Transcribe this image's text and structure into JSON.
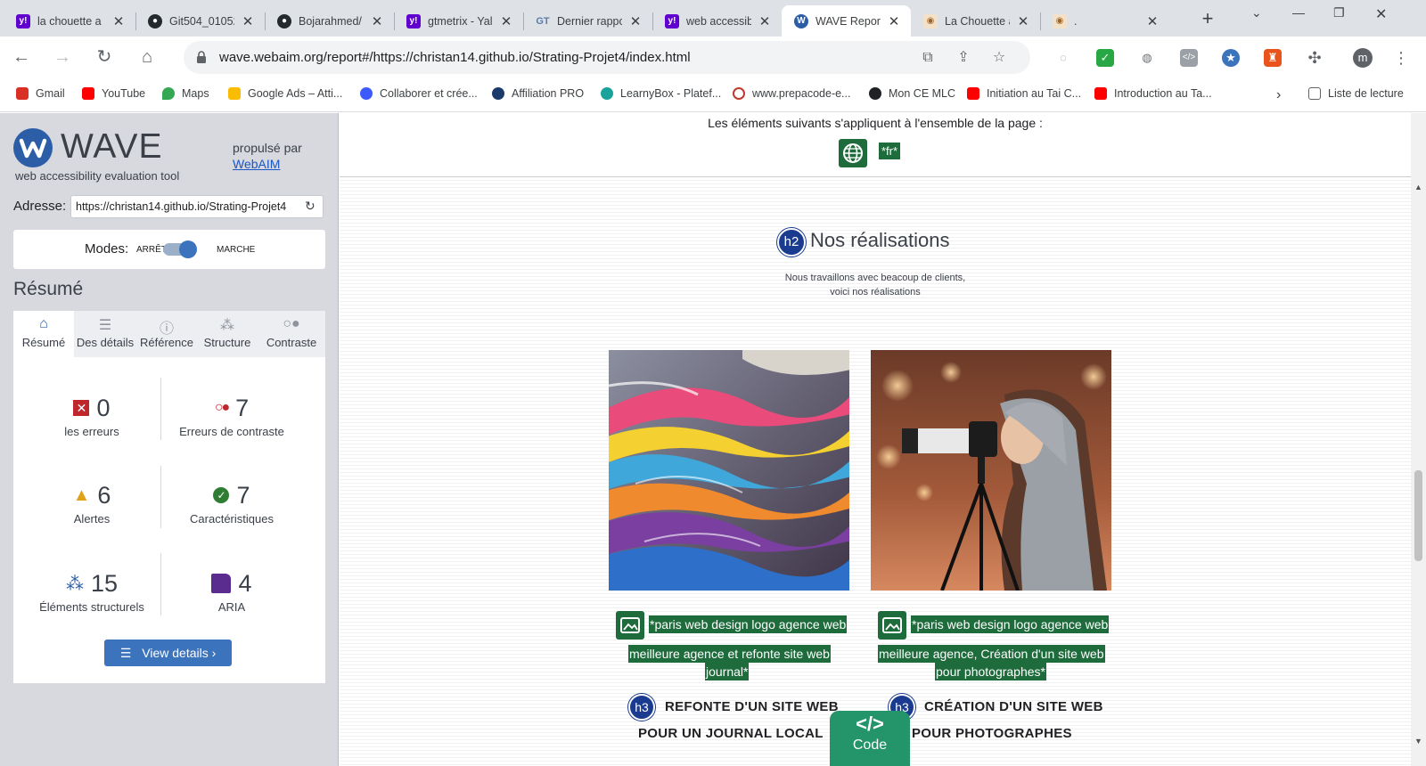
{
  "browser": {
    "tabs": [
      {
        "title": "la chouette a",
        "favicon": "yahoo-icon",
        "color": "#6001d2"
      },
      {
        "title": "Git504_01052",
        "favicon": "github-icon",
        "color": "#24292e"
      },
      {
        "title": "Bojarahmed/",
        "favicon": "github-icon",
        "color": "#24292e"
      },
      {
        "title": "gtmetrix - Yal",
        "favicon": "yahoo-icon",
        "color": "#6001d2"
      },
      {
        "title": "Dernier rappo",
        "favicon": "gtmetrix-icon",
        "color": "#5a7ca8"
      },
      {
        "title": "web accessib",
        "favicon": "yahoo-icon",
        "color": "#6001d2"
      },
      {
        "title": "WAVE Report",
        "favicon": "wave-icon",
        "color": "#2c5ea8"
      },
      {
        "title": "La Chouette a",
        "favicon": "owl-icon",
        "color": "#d9a35a"
      },
      {
        "title": ".",
        "favicon": "owl-icon",
        "color": "#d9a35a"
      }
    ],
    "url": "wave.webaim.org/report#/https://christan14.github.io/Strating-Projet4/index.html",
    "profile_initial": "m",
    "bookmarks": [
      {
        "label": "Gmail",
        "icon": "gmail-icon",
        "color": "#d93025"
      },
      {
        "label": "YouTube",
        "icon": "youtube-icon",
        "color": "#ff0000"
      },
      {
        "label": "Maps",
        "icon": "maps-icon",
        "color": "#34a853"
      },
      {
        "label": "Google Ads – Atti...",
        "icon": "google-ads-icon",
        "color": "#fbbc04"
      },
      {
        "label": "Collaborer et crée...",
        "icon": "collab-icon",
        "color": "#3d5afe"
      },
      {
        "label": "Affiliation PRO",
        "icon": "affiliation-icon",
        "color": "#1b3a6b"
      },
      {
        "label": "LearnyBox - Platef...",
        "icon": "learnybox-icon",
        "color": "#1aa39a"
      },
      {
        "label": "www.prepacode-e...",
        "icon": "prepacode-icon",
        "color": "#c0392b"
      },
      {
        "label": "Mon CE MLC",
        "icon": "mlc-icon",
        "color": "#202124"
      },
      {
        "label": "Initiation au Tai C...",
        "icon": "youtube-icon",
        "color": "#ff0000"
      },
      {
        "label": "Introduction au Ta...",
        "icon": "youtube-icon",
        "color": "#ff0000"
      }
    ],
    "reading_list": "Liste de lecture"
  },
  "wave": {
    "logo": "WAVE",
    "subtitle": "web accessibility evaluation tool",
    "powered_by": "propulsé par",
    "powered_link": "WebAIM",
    "address_label": "Adresse:",
    "address_value": "https://christan14.github.io/Strating-Projet4",
    "modes_label": "Modes:",
    "modes_off": "ARRÊT",
    "modes_on": "MARCHE",
    "summary_title": "Résumé",
    "tabs": [
      {
        "label": "Résumé",
        "icon": "home-icon"
      },
      {
        "label": "Des détails",
        "icon": "list-icon"
      },
      {
        "label": "Référence",
        "icon": "info-icon"
      },
      {
        "label": "Structure",
        "icon": "structure-icon"
      },
      {
        "label": "Contraste",
        "icon": "contrast-icon"
      }
    ],
    "stats": [
      {
        "value": "0",
        "label": "les erreurs",
        "icon": "error-icon",
        "color": "#c0272d"
      },
      {
        "value": "7",
        "label": "Erreurs de contraste",
        "icon": "contrast-error-icon",
        "color": "#c0272d"
      },
      {
        "value": "6",
        "label": "Alertes",
        "icon": "alert-icon",
        "color": "#e0a21a"
      },
      {
        "value": "7",
        "label": "Caractéristiques",
        "icon": "feature-icon",
        "color": "#2e7d32"
      },
      {
        "value": "15",
        "label": "Éléments structurels",
        "icon": "structural-icon",
        "color": "#2c5ea8"
      },
      {
        "value": "4",
        "label": "ARIA",
        "icon": "aria-icon",
        "color": "#5b2c8f"
      }
    ],
    "view_details": "View details ›"
  },
  "page": {
    "page_note": "Les éléments suivants s'appliquent à l'ensemble de la page :",
    "lang_tag": "*fr*",
    "h2_badge": "h2",
    "h2_text": "Nos réalisations",
    "intro_line1": "Nous travaillons avec beacoup de clients,",
    "intro_line2": "voici nos réalisations",
    "cards": [
      {
        "alt_line1": "*paris web design logo agence web",
        "alt_line2": "meilleure agence et refonte site web",
        "alt_line3": "journal*",
        "h3_badge": "h3",
        "h3_line1": "REFONTE D'UN SITE WEB",
        "h3_line2": "POUR UN JOURNAL LOCAL"
      },
      {
        "alt_line1": "*paris web design logo agence web",
        "alt_line2": "meilleure agence, Création d'un site web",
        "alt_line3": "pour photographes*",
        "h3_badge": "h3",
        "h3_line1": "CRÉATION D'UN SITE WEB",
        "h3_line2": "POUR PHOTOGRAPHES"
      }
    ],
    "code_icon": "</>",
    "code_label": "Code"
  }
}
